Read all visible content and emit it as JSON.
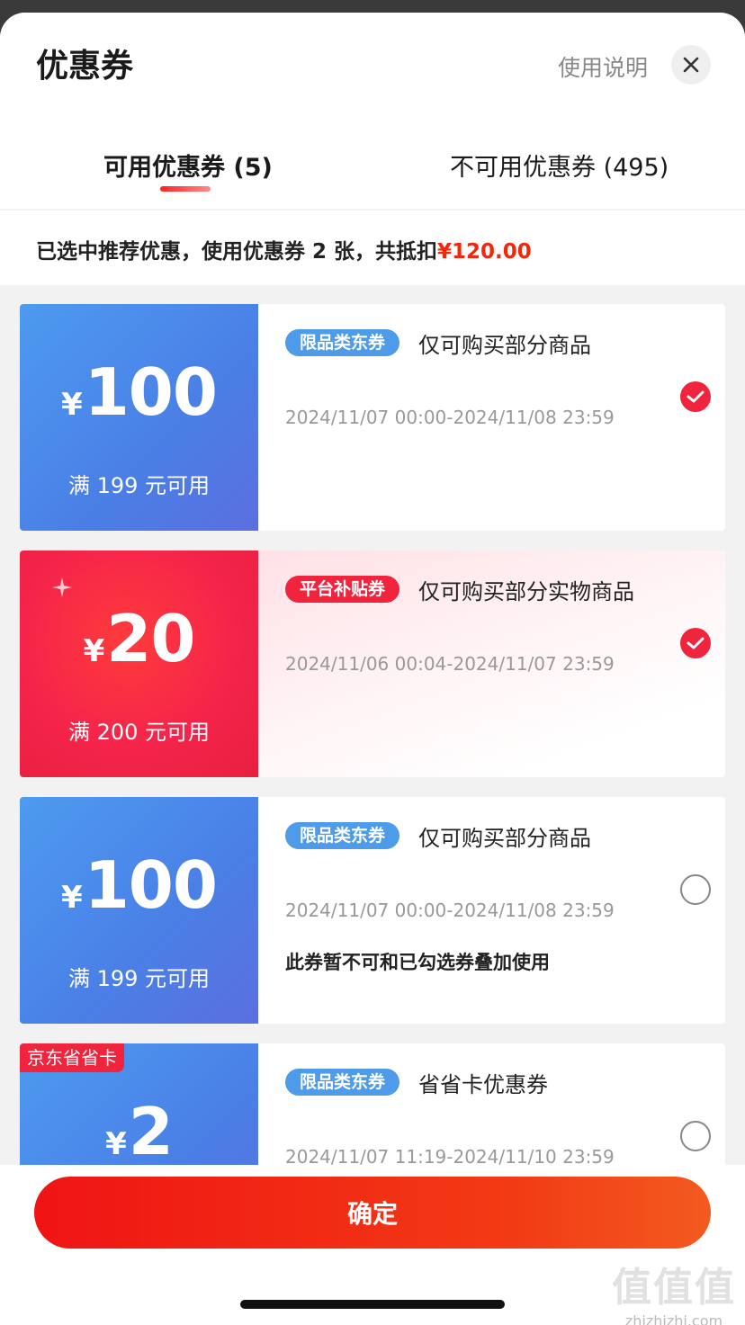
{
  "header": {
    "title": "优惠券",
    "help_label": "使用说明"
  },
  "tabs": [
    {
      "label": "可用优惠券 (5)",
      "active": true
    },
    {
      "label": "不可用优惠券 (495)",
      "active": false
    }
  ],
  "summary": {
    "text": "已选中推荐优惠，使用优惠券 2 张，共抵扣",
    "amount": "¥120.00"
  },
  "coupons": [
    {
      "currency": "¥",
      "amount": "100",
      "condition": "满 199 元可用",
      "badge": "限品类东券",
      "description": "仅可购买部分商品",
      "validity": "2024/11/07 00:00-2024/11/08 23:59",
      "note": "",
      "selected": true,
      "tag": ""
    },
    {
      "currency": "¥",
      "amount": "20",
      "condition": "满 200 元可用",
      "badge": "平台补贴券",
      "description": "仅可购买部分实物商品",
      "validity": "2024/11/06 00:04-2024/11/07 23:59",
      "note": "",
      "selected": true,
      "tag": ""
    },
    {
      "currency": "¥",
      "amount": "100",
      "condition": "满 199 元可用",
      "badge": "限品类东券",
      "description": "仅可购买部分商品",
      "validity": "2024/11/07 00:00-2024/11/08 23:59",
      "note": "此券暂不可和已勾选券叠加使用",
      "selected": false,
      "tag": ""
    },
    {
      "currency": "¥",
      "amount": "2",
      "condition": "",
      "badge": "限品类东券",
      "description": "省省卡优惠券",
      "validity": "2024/11/07 11:19-2024/11/10 23:59",
      "note": "",
      "selected": false,
      "tag": "京东省省卡"
    }
  ],
  "footer": {
    "confirm_label": "确定"
  },
  "watermark": {
    "logo": "值值值",
    "url": "zhizhizhi.com"
  },
  "colors": {
    "accent_red": "#f2270c",
    "badge_blue": "#4e9be9",
    "badge_red": "#f0243d"
  }
}
